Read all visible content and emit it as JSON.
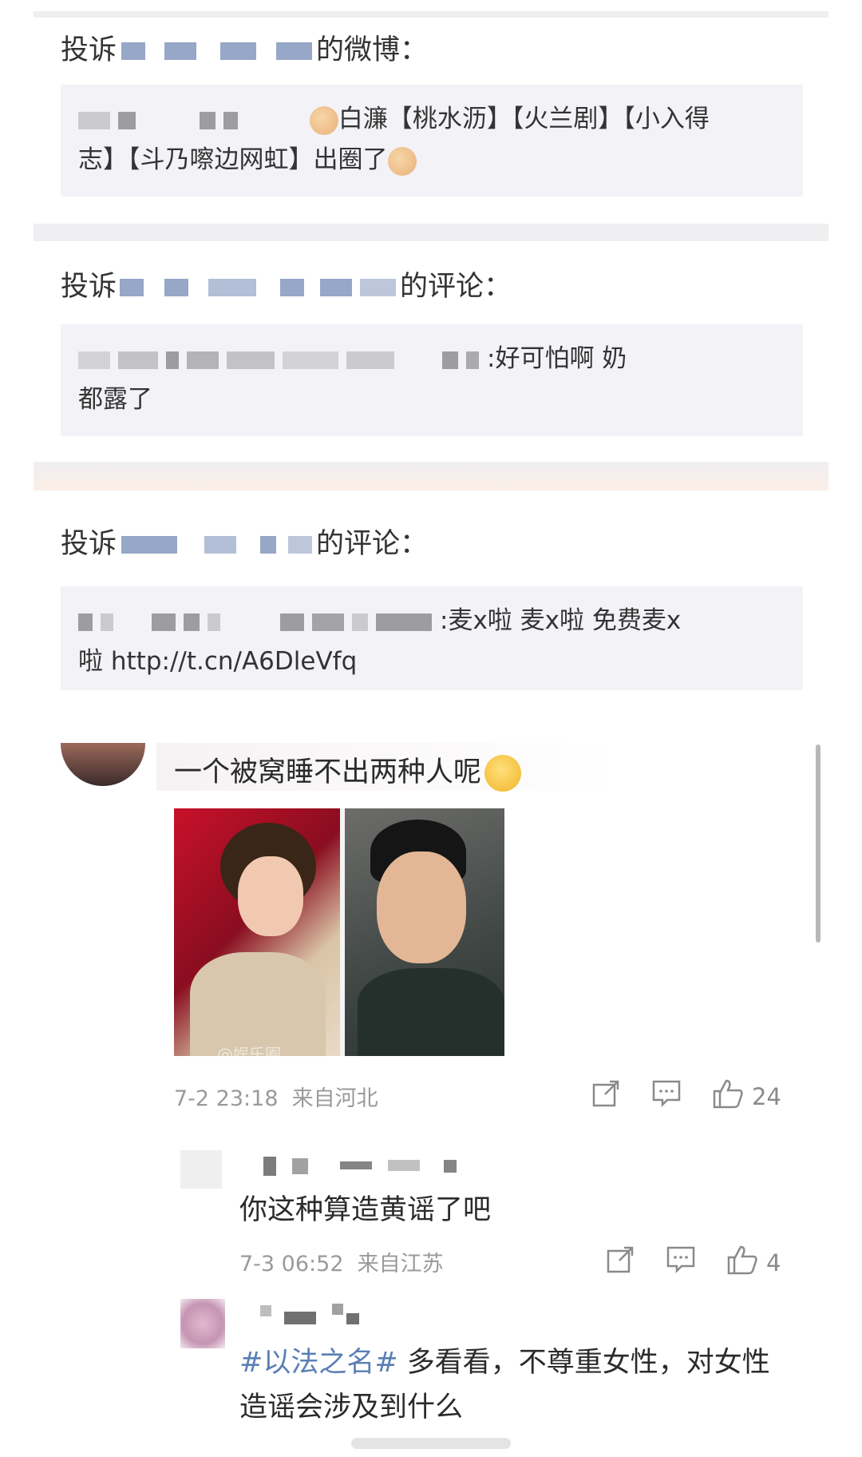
{
  "reports": [
    {
      "head_prefix": "投诉",
      "head_suffix": "的微博：",
      "body_line1": "白濂【桃水沥】【火兰剧】【小入得",
      "body_line2_a": "志】【斗乃嚓边网虹】出圈了"
    },
    {
      "head_prefix": "投诉",
      "head_suffix": "的评论：",
      "body_line1": ":好可怕啊 奶",
      "body_line2_a": "都露了"
    },
    {
      "head_prefix": "投诉",
      "head_suffix": "的评论：",
      "body_line1": ":麦x啦 麦x啦 免费麦x",
      "body_line2_a": "啦 ",
      "body_link": "http://t.cn/A6DleVfq"
    }
  ],
  "comment": {
    "text": "一个被窝睡不出两种人呢",
    "time": "7-2 23:18",
    "location": "来自河北",
    "like_count": "24",
    "photo_watermark": "@娱乐圈"
  },
  "reply1": {
    "text": "你这种算造黄谣了吧",
    "time": "7-3 06:52",
    "location": "来自江苏",
    "like_count": "4"
  },
  "reply2": {
    "hashtag": "#以法之名#",
    "text_a": " 多看看，不尊重女性，对女性",
    "text_b": "造谣会涉及到什么"
  },
  "icons": {
    "share": "share-icon",
    "comment": "comment-icon",
    "like": "thumbs-up-icon",
    "clap": "clapping-hands-emoji",
    "scream": "screaming-face-emoji"
  },
  "colors": {
    "quote_bg": "#f3f2f6",
    "meta_text": "#9a9a9a",
    "hashtag": "#5b7fb5"
  }
}
